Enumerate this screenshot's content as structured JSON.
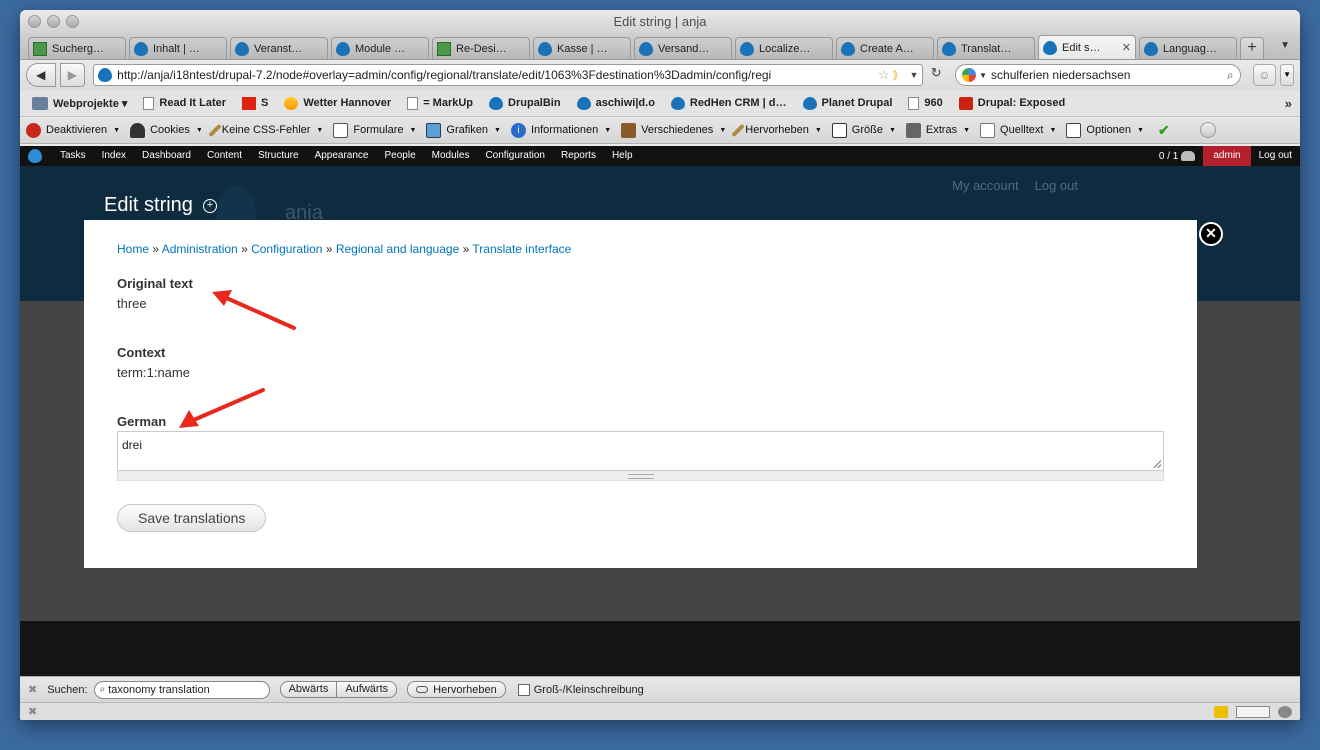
{
  "window": {
    "title": "Edit string | anja"
  },
  "tabs": [
    {
      "label": "Sucherg…",
      "icon": "green-icon"
    },
    {
      "label": "Inhalt | …",
      "icon": "drupal-icon"
    },
    {
      "label": "Veranst…",
      "icon": "drupal-icon"
    },
    {
      "label": "Module …",
      "icon": "drupal-icon"
    },
    {
      "label": "Re-Desi…",
      "icon": "green-icon"
    },
    {
      "label": "Kasse | …",
      "icon": "drupal-icon"
    },
    {
      "label": "Versand…",
      "icon": "drupal-icon"
    },
    {
      "label": "Localize…",
      "icon": "drupal-icon"
    },
    {
      "label": "Create A…",
      "icon": "drupal-icon"
    },
    {
      "label": "Translat…",
      "icon": "drupal-icon"
    },
    {
      "label": "Edit s…",
      "icon": "drupal-icon",
      "active": true
    },
    {
      "label": "Languag…",
      "icon": "drupal-icon"
    }
  ],
  "nav": {
    "url": "http://anja/i18ntest/drupal-7.2/node#overlay=admin/config/regional/translate/edit/1063%3Fdestination%3Dadmin/config/regi",
    "search_value": "schulferien niedersachsen"
  },
  "bookmarks": [
    {
      "label": "Webprojekte ▾",
      "icon": "folder-icon"
    },
    {
      "label": "Read It Later",
      "icon": "page-icon"
    },
    {
      "label": "S",
      "icon": "sparkasse-icon"
    },
    {
      "label": "Wetter Hannover",
      "icon": "weather-icon"
    },
    {
      "label": "= MarkUp",
      "icon": "page-icon"
    },
    {
      "label": "DrupalBin",
      "icon": "drupal-icon"
    },
    {
      "label": "aschiwi|d.o",
      "icon": "drupal-icon"
    },
    {
      "label": "RedHen CRM | d…",
      "icon": "drupal-icon"
    },
    {
      "label": "Planet Drupal",
      "icon": "drupal-icon"
    },
    {
      "label": "960",
      "icon": "page-icon"
    },
    {
      "label": "Drupal: Exposed",
      "icon": "crm-icon"
    }
  ],
  "devtools": [
    {
      "label": "Deaktivieren",
      "icon": "stop-icon"
    },
    {
      "label": "Cookies",
      "icon": "person-icon"
    },
    {
      "label": "Keine CSS-Fehler",
      "icon": "pen-icon"
    },
    {
      "label": "Formulare",
      "icon": "form-icon"
    },
    {
      "label": "Grafiken",
      "icon": "image-icon"
    },
    {
      "label": "Informationen",
      "icon": "info-icon"
    },
    {
      "label": "Verschiedenes",
      "icon": "misc-icon"
    },
    {
      "label": "Hervorheben",
      "icon": "pen-icon"
    },
    {
      "label": "Größe",
      "icon": "size-icon"
    },
    {
      "label": "Extras",
      "icon": "tools-icon"
    },
    {
      "label": "Quelltext",
      "icon": "source-icon"
    },
    {
      "label": "Optionen",
      "icon": "options-icon"
    }
  ],
  "toolbar": {
    "items": [
      "Tasks",
      "Index",
      "Dashboard",
      "Content",
      "Structure",
      "Appearance",
      "People",
      "Modules",
      "Configuration",
      "Reports",
      "Help"
    ],
    "counter": "0 / 1",
    "user": "admin",
    "logout": "Log out"
  },
  "site": {
    "name": "anja",
    "my_account": "My account",
    "log_out": "Log out"
  },
  "overlay": {
    "title": "Edit string",
    "breadcrumb": [
      "Home",
      "Administration",
      "Configuration",
      "Regional and language",
      "Translate interface"
    ],
    "original_label": "Original text",
    "original_value": "three",
    "context_label": "Context",
    "context_value": "term:1:name",
    "german_label": "German",
    "german_value": "drei",
    "save_label": "Save translations"
  },
  "findbar": {
    "label": "Suchen:",
    "value": "taxonomy translation",
    "prev": "Abwärts",
    "next": "Aufwärts",
    "highlight": "Hervorheben",
    "match_case": "Groß-/Kleinschreibung"
  },
  "colors": {
    "toolbar_bg": "#111111",
    "admin_badge": "#b3202b",
    "link": "#0074bd",
    "arrow": "#e8281e"
  }
}
